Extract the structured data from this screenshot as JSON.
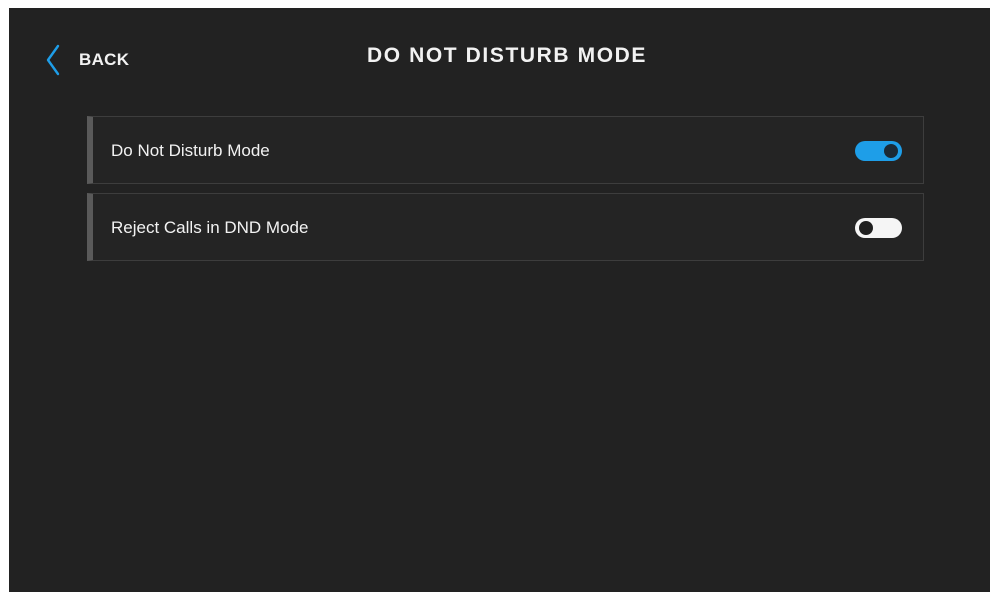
{
  "header": {
    "back_label": "BACK",
    "back_icon": "chevron-left-icon",
    "title": "DO NOT DISTURB MODE"
  },
  "settings": [
    {
      "label": "Do Not Disturb Mode",
      "enabled": true
    },
    {
      "label": "Reject Calls in DND Mode",
      "enabled": false
    }
  ],
  "colors": {
    "background": "#222222",
    "accent": "#1e9ee8",
    "text": "#f2f2f2",
    "row_border": "#3d3d3d",
    "row_marker": "#5a5a5a"
  }
}
